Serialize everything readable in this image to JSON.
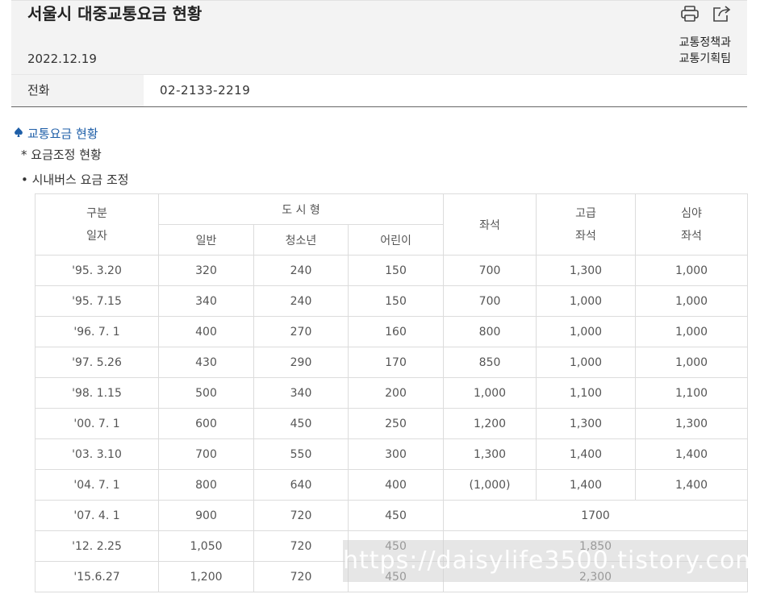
{
  "header": {
    "title": "서울시 대중교통요금 현황",
    "date": "2022.12.19",
    "dept_line1": "교통정책과",
    "dept_line2": "교통기획팀"
  },
  "contact": {
    "label": "전화",
    "phone": "02-2133-2219"
  },
  "section": {
    "title": "교통요금 현황",
    "sub1": "* 요금조정 현황",
    "sub2": "• 시내버스 요금 조정"
  },
  "table": {
    "h_gubun": "구분",
    "h_ilja": "일자",
    "h_dosi": "도 시 형",
    "h_ilban": "일반",
    "h_chungso": "청소년",
    "h_eorini": "어린이",
    "h_jwaseok": "좌석",
    "h_gogeup": "고급",
    "h_gogeup_jwaseok": "좌석",
    "h_simya": "심야",
    "h_simya_jwaseok": "좌석",
    "rows": [
      {
        "date": "'95. 3.20",
        "ilban": "320",
        "chungso": "240",
        "eorini": "150",
        "jwaseok": "700",
        "gogeup": "1,300",
        "simya": "1,000"
      },
      {
        "date": "'95. 7.15",
        "ilban": "340",
        "chungso": "240",
        "eorini": "150",
        "jwaseok": "700",
        "gogeup": "1,000",
        "simya": "1,000"
      },
      {
        "date": "'96. 7. 1",
        "ilban": "400",
        "chungso": "270",
        "eorini": "160",
        "jwaseok": "800",
        "gogeup": "1,000",
        "simya": "1,000"
      },
      {
        "date": "'97. 5.26",
        "ilban": "430",
        "chungso": "290",
        "eorini": "170",
        "jwaseok": "850",
        "gogeup": "1,000",
        "simya": "1,000"
      },
      {
        "date": "'98. 1.15",
        "ilban": "500",
        "chungso": "340",
        "eorini": "200",
        "jwaseok": "1,000",
        "gogeup": "1,100",
        "simya": "1,100"
      },
      {
        "date": "'00. 7. 1",
        "ilban": "600",
        "chungso": "450",
        "eorini": "250",
        "jwaseok": "1,200",
        "gogeup": "1,300",
        "simya": "1,300"
      },
      {
        "date": "'03. 3.10",
        "ilban": "700",
        "chungso": "550",
        "eorini": "300",
        "jwaseok": "1,300",
        "gogeup": "1,400",
        "simya": "1,400"
      },
      {
        "date": "'04. 7. 1",
        "ilban": "800",
        "chungso": "640",
        "eorini": "400",
        "jwaseok": "(1,000)",
        "gogeup": "1,400",
        "simya": "1,400"
      }
    ],
    "merged_rows": [
      {
        "date": "'07. 4. 1",
        "ilban": "900",
        "chungso": "720",
        "eorini": "450",
        "merged": "1700"
      },
      {
        "date": "'12. 2.25",
        "ilban": "1,050",
        "chungso": "720",
        "eorini": "450",
        "merged": "1,850"
      },
      {
        "date": "'15.6.27",
        "ilban": "1,200",
        "chungso": "720",
        "eorini": "450",
        "merged": "2,300"
      }
    ]
  },
  "watermark": "https://daisylife3500.tistory.com"
}
